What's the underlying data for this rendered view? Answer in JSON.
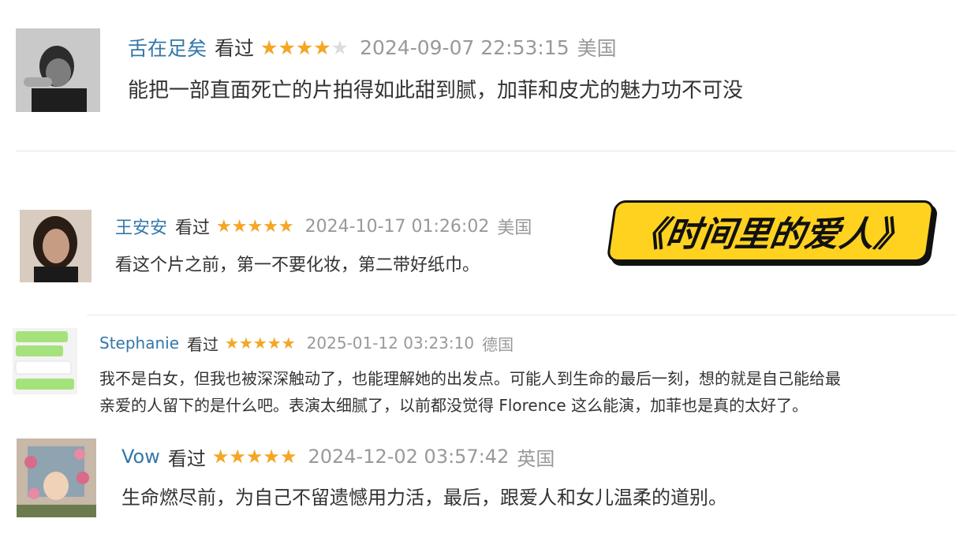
{
  "overlay_title": "《时间里的爱人》",
  "reviews": [
    {
      "user": "舌在足矣",
      "watched": "看过",
      "rating": 4,
      "date": "2024-09-07 22:53:15",
      "location": "美国",
      "text": "能把一部直面死亡的片拍得如此甜到腻，加菲和皮尤的魅力功不可没"
    },
    {
      "user": "王安安",
      "watched": "看过",
      "rating": 5,
      "date": "2024-10-17 01:26:02",
      "location": "美国",
      "text": "看这个片之前，第一不要化妆，第二带好纸巾。"
    },
    {
      "user": "Stephanie",
      "watched": "看过",
      "rating": 5,
      "date": "2025-01-12 03:23:10",
      "location": "德国",
      "text_line1": "我不是白女，但我也被深深触动了，也能理解她的出发点。可能人到生命的最后一刻，想的就是自己能给最",
      "text_line2": "亲爱的人留下的是什么吧。表演太细腻了，以前都没觉得 Florence 这么能演，加菲也是真的太好了。"
    },
    {
      "user": "Vow",
      "watched": "看过",
      "rating": 5,
      "date": "2024-12-02 03:57:42",
      "location": "英国",
      "text": "生命燃尽前，为自己不留遗憾用力活，最后，跟爱人和女儿温柔的道别。"
    }
  ],
  "colors": {
    "username": "#3377aa",
    "star": "#f5a623",
    "meta": "#999999"
  }
}
